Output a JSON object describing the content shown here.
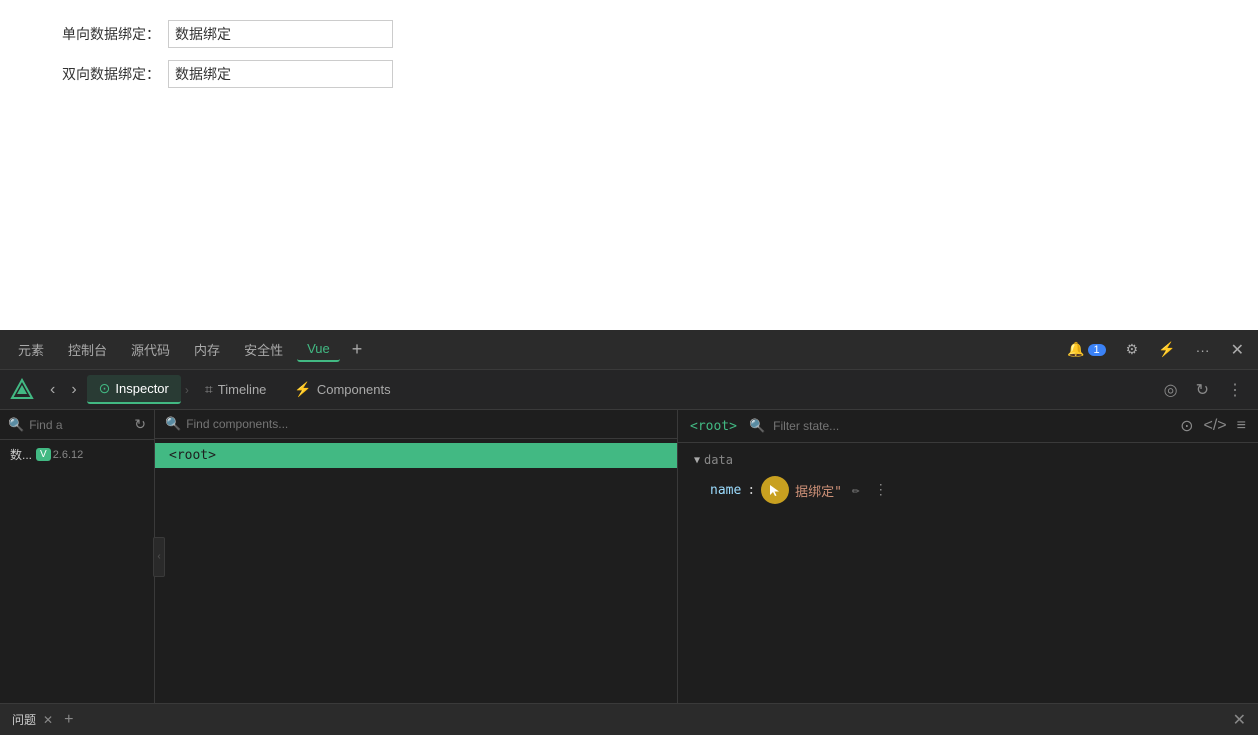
{
  "mainContent": {
    "row1": {
      "label": "单向数据绑定：",
      "value": "数据绑定"
    },
    "row2": {
      "label": "双向数据绑定：",
      "value": "数据绑定"
    }
  },
  "devtoolsTopbar": {
    "tabs": [
      {
        "label": "元素",
        "active": false
      },
      {
        "label": "控制台",
        "active": false
      },
      {
        "label": "源代码",
        "active": false
      },
      {
        "label": "内存",
        "active": false
      },
      {
        "label": "安全性",
        "active": false
      },
      {
        "label": "Vue",
        "active": true
      }
    ],
    "addTab": "+",
    "badgeCount": "1",
    "moreLabel": "···",
    "closeLabel": "✕"
  },
  "vueDevtoolsBar": {
    "backBtn": "‹",
    "forwardBtn": "›",
    "tabs": [
      {
        "label": "Inspector",
        "active": true,
        "hasIcon": true
      },
      {
        "label": "Timeline",
        "active": false,
        "hasIcon": true
      },
      {
        "label": "Components",
        "active": false,
        "hasIcon": true
      }
    ],
    "chevron": "›"
  },
  "leftPanel": {
    "searchPlaceholder": "Find a",
    "refreshBtn": "↻",
    "instance": {
      "vueBadge": "V",
      "version": "2.6.12",
      "prefix": "数..."
    }
  },
  "middlePanel": {
    "searchPlaceholder": "Find components...",
    "components": [
      {
        "tag": "<root>",
        "selected": true
      }
    ]
  },
  "rightPanel": {
    "componentTag": "<root>",
    "filterPlaceholder": "Filter state...",
    "data": {
      "sectionTitle": "data",
      "rows": [
        {
          "key": "name",
          "colon": ":",
          "value": "\"据绑定\""
        }
      ]
    },
    "icons": {
      "camera": "⊙",
      "code": "</>",
      "list": "≡"
    }
  },
  "statusBar": {
    "tabLabel": "问题",
    "addBtn": "+",
    "closeMain": "✕"
  }
}
